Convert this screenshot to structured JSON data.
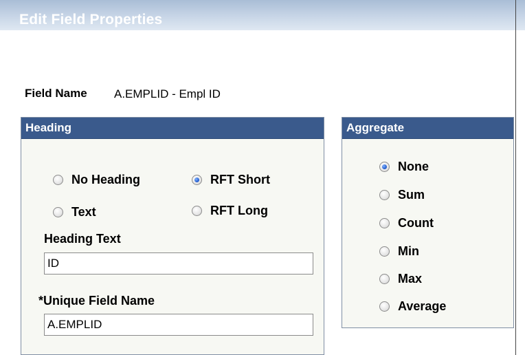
{
  "dialog": {
    "title": "Edit Field Properties"
  },
  "field_name": {
    "label": "Field Name",
    "value": "A.EMPLID - Empl ID"
  },
  "heading": {
    "title": "Heading",
    "options": [
      {
        "label": "No Heading",
        "checked": false
      },
      {
        "label": "RFT Short",
        "checked": true
      },
      {
        "label": "Text",
        "checked": false
      },
      {
        "label": "RFT Long",
        "checked": false
      }
    ],
    "heading_text_label": "Heading Text",
    "heading_text_value": "ID",
    "unique_field_label": "*Unique Field Name",
    "unique_field_value": "A.EMPLID"
  },
  "aggregate": {
    "title": "Aggregate",
    "options": [
      {
        "label": "None",
        "checked": true
      },
      {
        "label": "Sum",
        "checked": false
      },
      {
        "label": "Count",
        "checked": false
      },
      {
        "label": "Min",
        "checked": false
      },
      {
        "label": "Max",
        "checked": false
      },
      {
        "label": "Average",
        "checked": false
      }
    ]
  }
}
